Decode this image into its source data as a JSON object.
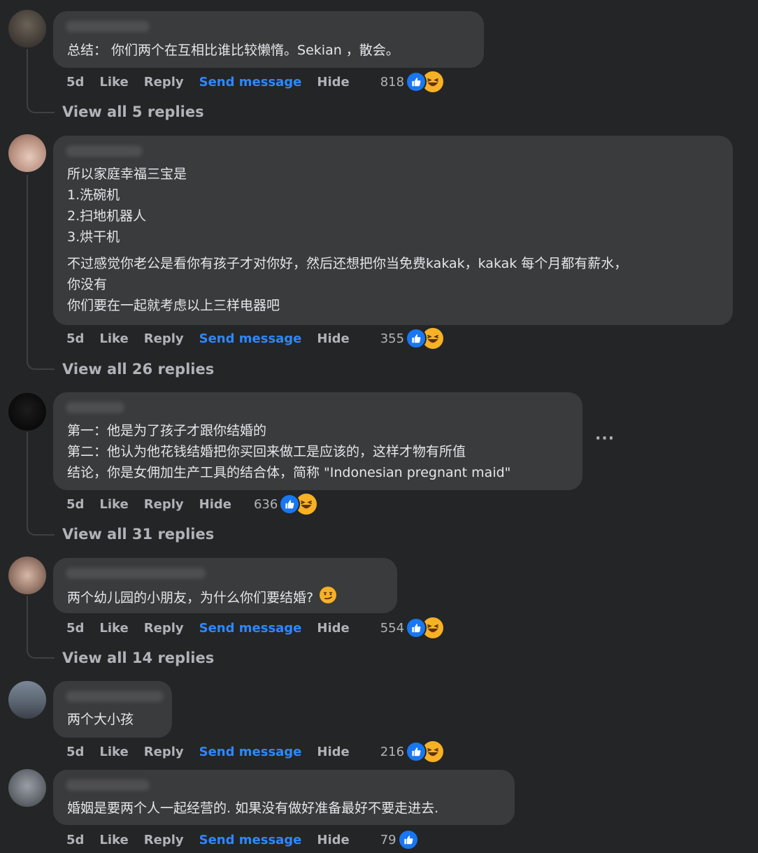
{
  "comments": [
    {
      "lines": [
        "总结： 你们两个在互相比谁比较懒惰。Sekian ，散会。"
      ],
      "time": "5d",
      "like": "Like",
      "reply": "Reply",
      "send": "Send message",
      "hide": "Hide",
      "count": "818",
      "replies": "View all 5 replies",
      "reactions": [
        "like-icon",
        "haha-icon"
      ]
    },
    {
      "lines": [
        "所以家庭幸福三宝是",
        "1.洗碗机",
        "2.扫地机器人",
        "3.烘干机"
      ],
      "para2": [
        "不过感觉你老公是看你有孩子才对你好，然后还想把你当免费kakak，kakak 每个月都有薪水，",
        "你没有",
        "你们要在一起就考虑以上三样电器吧"
      ],
      "time": "5d",
      "like": "Like",
      "reply": "Reply",
      "send": "Send message",
      "hide": "Hide",
      "count": "355",
      "replies": "View all 26 replies",
      "reactions": [
        "like-icon",
        "haha-icon"
      ]
    },
    {
      "lines": [
        "第一：他是为了孩子才跟你结婚的",
        "第二：他认为他花钱结婚把你买回来做工是应该的，这样才物有所值",
        "结论，你是女佣加生产工具的结合体，简称 \"Indonesian pregnant maid\""
      ],
      "time": "5d",
      "like": "Like",
      "reply": "Reply",
      "hide": "Hide",
      "count": "636",
      "replies": "View all 31 replies",
      "more": "···",
      "reactions": [
        "like-icon",
        "haha-icon"
      ]
    },
    {
      "lines": [
        "两个幼儿园的小朋友，为什么你们要结婚?"
      ],
      "emoji": "smirk-emoji",
      "time": "5d",
      "like": "Like",
      "reply": "Reply",
      "send": "Send message",
      "hide": "Hide",
      "count": "554",
      "replies": "View all 14 replies",
      "reactions": [
        "like-icon",
        "haha-icon"
      ]
    },
    {
      "lines": [
        "两个大小孩"
      ],
      "time": "5d",
      "like": "Like",
      "reply": "Reply",
      "send": "Send message",
      "hide": "Hide",
      "count": "216",
      "reactions": [
        "like-icon",
        "haha-icon"
      ]
    },
    {
      "lines": [
        "婚姻是要两个人一起经营的. 如果没有做好准备最好不要走进去."
      ],
      "time": "5d",
      "like": "Like",
      "reply": "Reply",
      "send": "Send message",
      "hide": "Hide",
      "count": "79",
      "reactions": [
        "like-icon"
      ]
    }
  ],
  "colors": {
    "background": "#242526",
    "bubble": "#3a3b3c",
    "link": "#2d88ff",
    "like_blue": "#1877f2",
    "haha_yellow": "#f7b125"
  }
}
